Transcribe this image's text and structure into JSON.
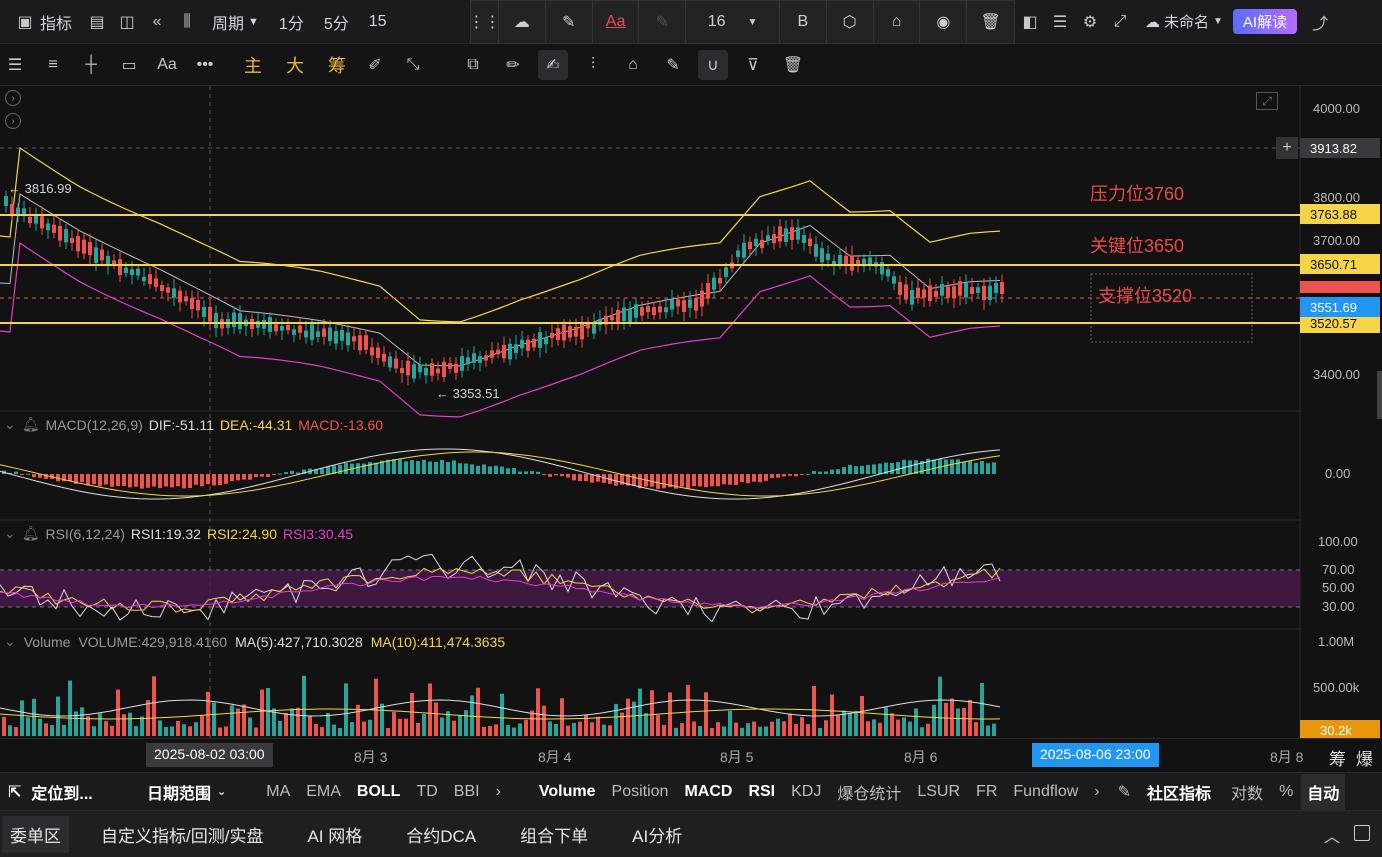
{
  "topbar": {
    "indicator_label": "指标",
    "period_label": "周期",
    "intervals": [
      "1分",
      "5分",
      "15"
    ],
    "untitled_label": "未命名",
    "ai_read_label": "AI解读",
    "font_size_value": "16",
    "bold_label": "B",
    "text_label": "Aa"
  },
  "toolbar2": {
    "aa_label": "Aa",
    "main_label": "主",
    "big_label": "大",
    "chip_label": "筹"
  },
  "price_axis": {
    "ticks": [
      "4000.00",
      "3800.00",
      "3700.00",
      "3400.00"
    ],
    "crosshair_price": "3913.82",
    "res_tag": "3763.88",
    "key_tag": "3650.71",
    "current_tag": "3551.69",
    "sup_tag": "3520.57"
  },
  "annotations": {
    "resistance": "压力位3760",
    "key": "关键位3650",
    "support": "支撑位3520",
    "high_label": "← 3816.99",
    "low_label": "← 3353.51"
  },
  "macd": {
    "title": "MACD(12,26,9)",
    "dif": "DIF:-51.11",
    "dea": "DEA:-44.31",
    "macd": "MACD:-13.60",
    "axis": "0.00"
  },
  "rsi": {
    "title": "RSI(6,12,24)",
    "rsi1": "RSI1:19.32",
    "rsi2": "RSI2:24.90",
    "rsi3": "RSI3:30.45",
    "axis": [
      "100.00",
      "70.00",
      "50.00",
      "30.00"
    ]
  },
  "volume": {
    "title": "Volume",
    "volume": "VOLUME:429,918.4160",
    "ma5": "MA(5):427,710.3028",
    "ma10": "MA(10):411,474.3635",
    "axis": [
      "1.00M",
      "500.00k"
    ],
    "current_tag": "30.2k"
  },
  "timebar": {
    "crosshair_time": "2025-08-02 03:00",
    "labels": [
      "8月 3",
      "8月 4",
      "8月 5",
      "8月 6",
      "8月 8"
    ],
    "range_end": "2025-08-06 23:00",
    "right_icons": [
      "筹",
      "爆"
    ]
  },
  "bottombar": {
    "locate": "定位到...",
    "date_range": "日期范围",
    "main_indicators": [
      "MA",
      "EMA",
      "BOLL",
      "TD",
      "BBI"
    ],
    "sub_indicators": [
      "Volume",
      "Position",
      "MACD",
      "RSI",
      "KDJ",
      "爆仓统计",
      "LSUR",
      "FR",
      "Fundflow"
    ],
    "community": "社区指标",
    "log": "对数",
    "percent": "%",
    "auto": "自动"
  },
  "footer": {
    "tabs": [
      "委单区",
      "自定义指标/回测/实盘",
      "AI 网格",
      "合约DCA",
      "组合下单",
      "AI分析"
    ]
  },
  "colors": {
    "up": "#26a69a",
    "down": "#ef5350",
    "level": "#f5d547",
    "annotation": "#e84b4b",
    "mid_band": "#bdbdbd",
    "lower_band": "#e040c8"
  }
}
